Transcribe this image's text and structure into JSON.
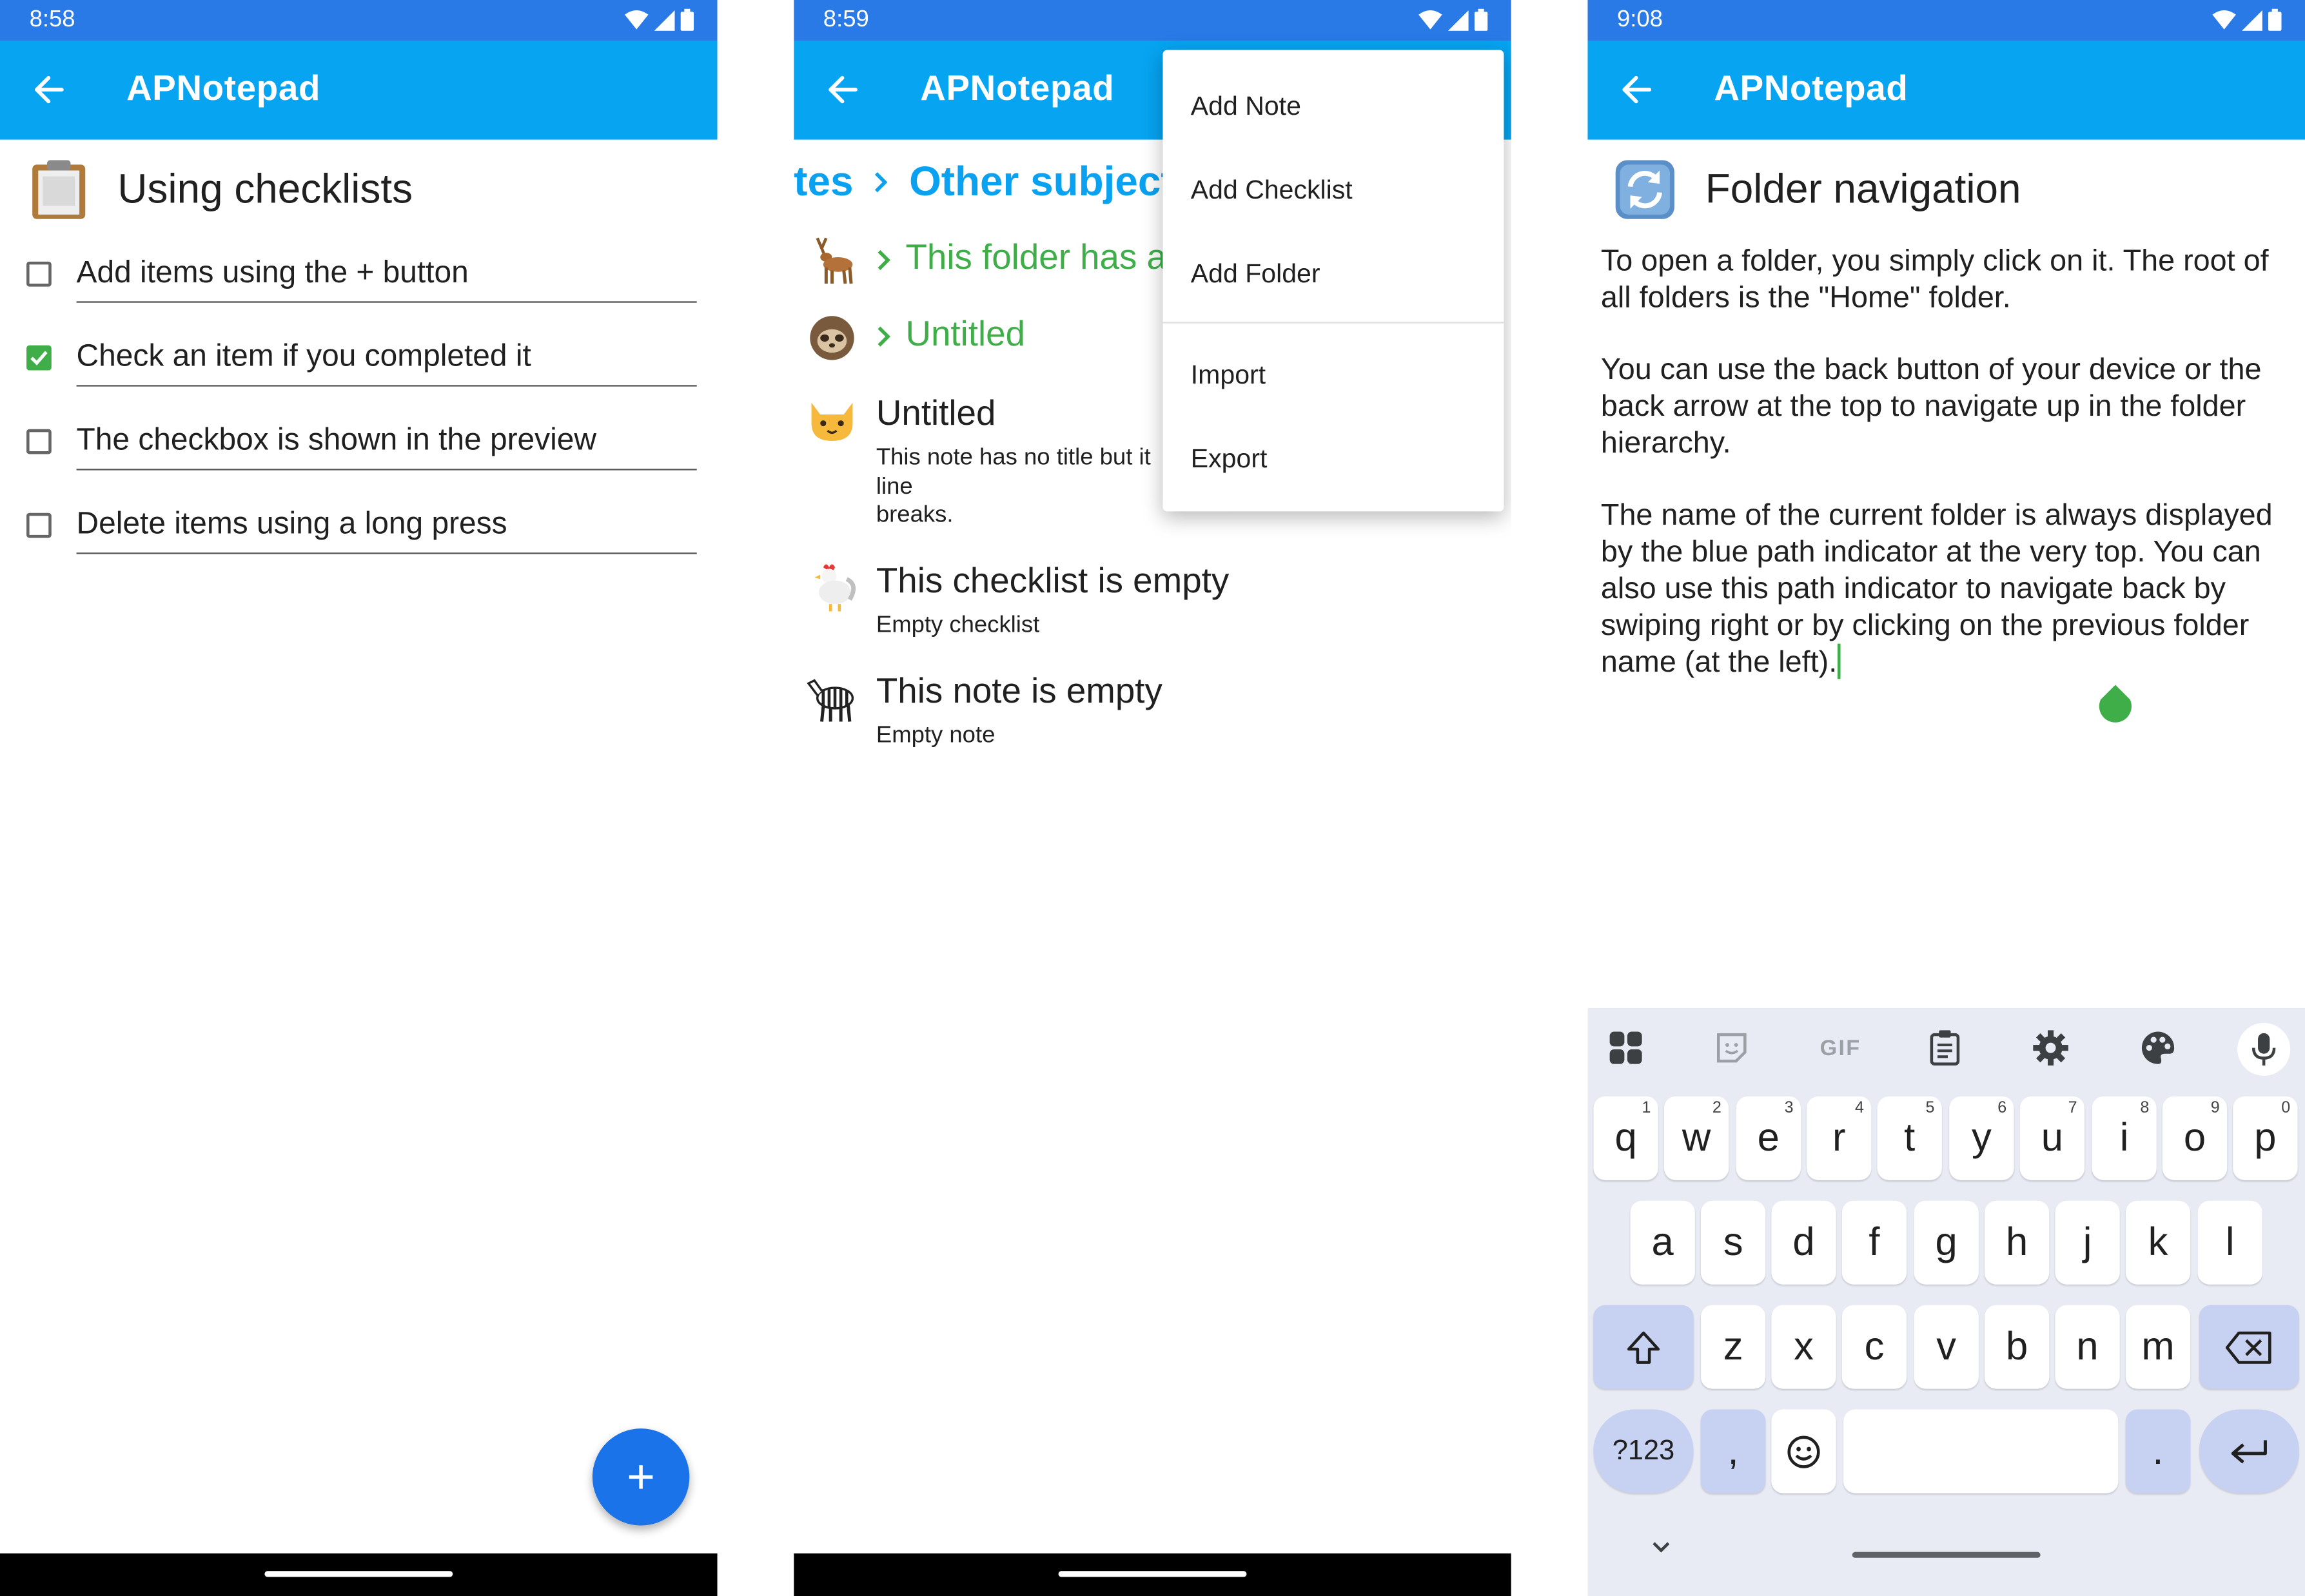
{
  "app": {
    "title": "APNotepad",
    "colors": {
      "status_bar": "#2979e6",
      "app_bar": "#06a4f1",
      "folder_green": "#3fae49",
      "breadcrumb_blue": "#0aa1f0",
      "fab": "#1a73e8",
      "keyboard_bg": "#e8eaf4",
      "keyboard_mod_key": "#c7d1f1"
    }
  },
  "screens": [
    {
      "time": "8:58",
      "status_icons": [
        "wifi-icon",
        "signal-icon",
        "battery-icon"
      ],
      "back_icon": "arrow-left-icon",
      "note_icon": "clipboard-icon",
      "note_title": "Using checklists",
      "items": [
        {
          "text": "Add items using the + button",
          "checked": false
        },
        {
          "text": "Check an item if you completed it",
          "checked": true
        },
        {
          "text": "The checkbox is shown in the preview",
          "checked": false
        },
        {
          "text": "Delete items using a long press",
          "checked": false
        }
      ],
      "fab_icon": "plus-icon"
    },
    {
      "time": "8:59",
      "breadcrumb": [
        "tes",
        "Other subjects"
      ],
      "folders": [
        {
          "icon": "deer-icon",
          "name": "This folder has a"
        },
        {
          "icon": "sloth-icon",
          "name": "Untitled"
        }
      ],
      "notes": [
        {
          "icon": "cat-icon",
          "title": "Untitled",
          "subtitle_lines": [
            "This note has no title but it",
            "line",
            "breaks."
          ]
        },
        {
          "icon": "rooster-icon",
          "title": "This checklist is empty",
          "subtitle_lines": [
            "Empty checklist"
          ]
        },
        {
          "icon": "zebra-icon",
          "title": "This note is empty",
          "subtitle_lines": [
            "Empty note"
          ]
        }
      ],
      "menu": [
        "Add Note",
        "Add Checklist",
        "Add Folder",
        "Import",
        "Export"
      ]
    },
    {
      "time": "9:08",
      "doc_icon": "refresh-icon",
      "doc_title": "Folder navigation",
      "paragraphs": [
        "To open a folder, you simply click on it. The root of all folders is the \"Home\" folder.",
        "You can use the back button of your device or the back arrow at the top to navigate up in the folder hierarchy.",
        "The name of the current folder is always displayed by the blue path indicator at the very top. You can also use this path indicator to navigate back by swiping right or by clicking on the previous folder name (at the left)."
      ],
      "keyboard": {
        "toolbar": [
          "apps-icon",
          "sticker-icon",
          "GIF",
          "clipboard-icon",
          "settings-icon",
          "palette-icon",
          "mic-icon"
        ],
        "row1": [
          [
            "q",
            "1"
          ],
          [
            "w",
            "2"
          ],
          [
            "e",
            "3"
          ],
          [
            "r",
            "4"
          ],
          [
            "t",
            "5"
          ],
          [
            "y",
            "6"
          ],
          [
            "u",
            "7"
          ],
          [
            "i",
            "8"
          ],
          [
            "o",
            "9"
          ],
          [
            "p",
            "0"
          ]
        ],
        "row2": [
          "a",
          "s",
          "d",
          "f",
          "g",
          "h",
          "j",
          "k",
          "l"
        ],
        "row3": [
          "z",
          "x",
          "c",
          "v",
          "b",
          "n",
          "m"
        ],
        "symbols_key": "?123",
        "comma": ",",
        "period": "."
      }
    }
  ]
}
